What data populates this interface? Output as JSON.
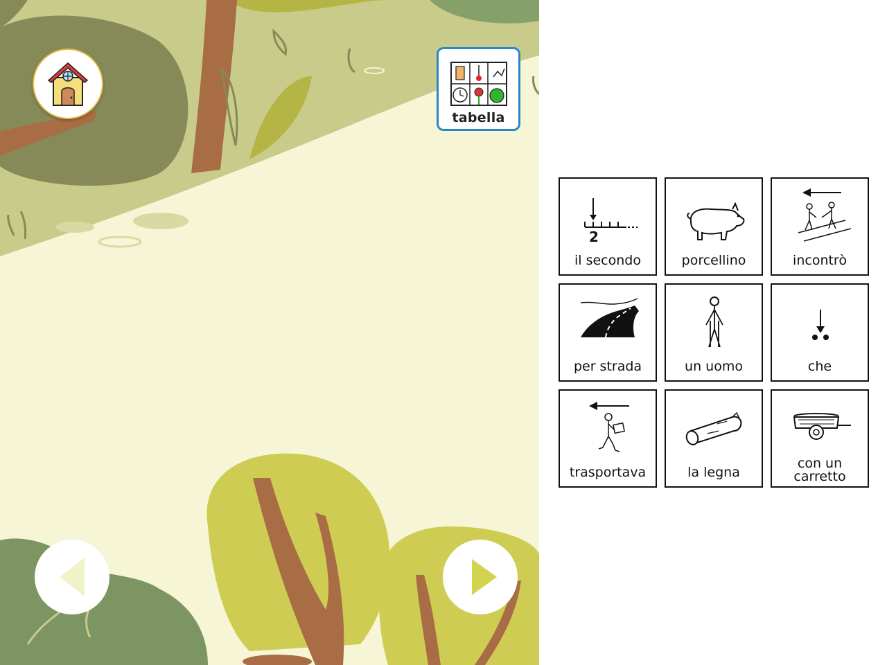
{
  "story_scene": {
    "home_icon": "house-icon",
    "board_button": {
      "label": "tabella",
      "icon": "symbol-board-icon"
    },
    "prev_icon": "left-triangle-icon",
    "next_icon": "right-triangle-icon",
    "colors": {
      "background": "#f6f6d6",
      "hill": "#c9cb8a",
      "dark_foliage": "#858a58",
      "trunk": "#a96d45",
      "foliage_light": "#cfcc54",
      "foliage_green": "#7d9563",
      "next_arrow": "#d2d44f",
      "prev_arrow": "#f0f3c8",
      "board_border": "#2a86c8"
    }
  },
  "symbol_grid": {
    "cards": [
      {
        "label": "il secondo",
        "icon": "ordinal-second-icon"
      },
      {
        "label": "porcellino",
        "icon": "pig-icon"
      },
      {
        "label": "incontrò",
        "icon": "meet-icon"
      },
      {
        "label": "per strada",
        "icon": "road-icon"
      },
      {
        "label": "un uomo",
        "icon": "man-icon"
      },
      {
        "label": "che",
        "icon": "that-icon"
      },
      {
        "label": "trasportava",
        "icon": "carry-icon"
      },
      {
        "label": "la legna",
        "icon": "log-icon"
      },
      {
        "label": "con un\ncarretto",
        "icon": "cart-icon"
      }
    ]
  }
}
